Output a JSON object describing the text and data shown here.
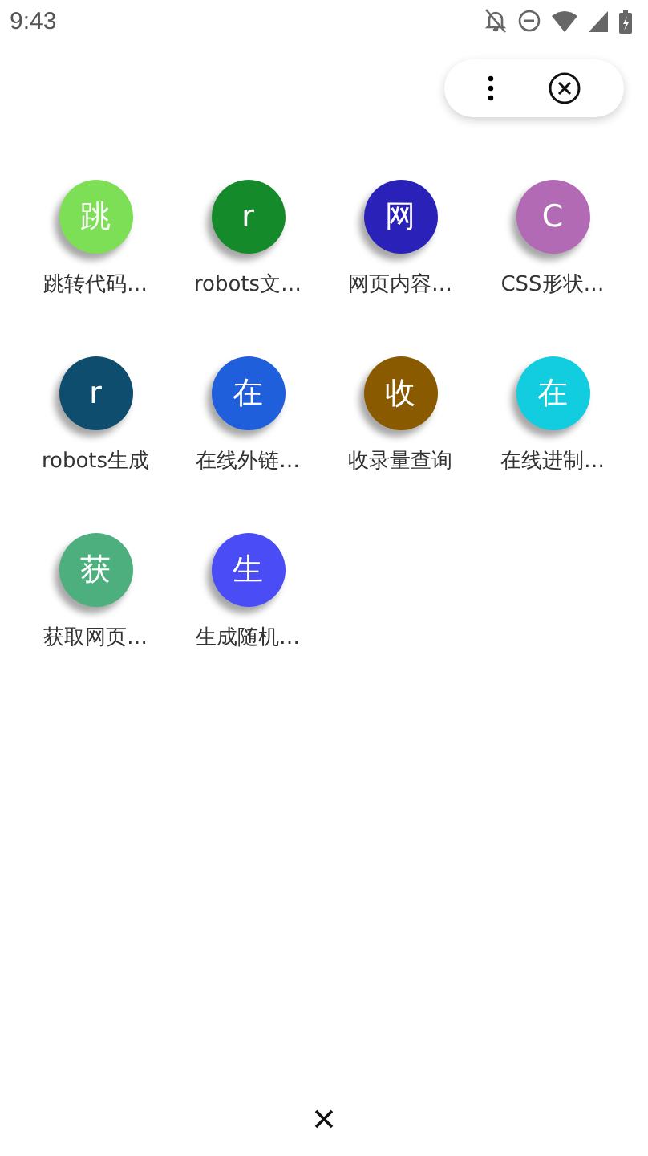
{
  "status_bar": {
    "time": "9:43"
  },
  "tools": [
    {
      "initial": "跳",
      "label": "跳转代码…",
      "color": "#7ddf55"
    },
    {
      "initial": "r",
      "label": "robots文…",
      "color": "#158a2a"
    },
    {
      "initial": "网",
      "label": "网页内容…",
      "color": "#2a22b8"
    },
    {
      "initial": "C",
      "label": "CSS形状…",
      "color": "#b36ab5"
    },
    {
      "initial": "r",
      "label": "robots生成",
      "color": "#0f4d6e"
    },
    {
      "initial": "在",
      "label": "在线外链…",
      "color": "#1f5fdc"
    },
    {
      "initial": "收",
      "label": "收录量查询",
      "color": "#8a5a00"
    },
    {
      "initial": "在",
      "label": "在线进制…",
      "color": "#12cde0"
    },
    {
      "initial": "获",
      "label": "获取网页…",
      "color": "#4caf7d"
    },
    {
      "initial": "生",
      "label": "生成随机…",
      "color": "#4a4df5"
    }
  ]
}
